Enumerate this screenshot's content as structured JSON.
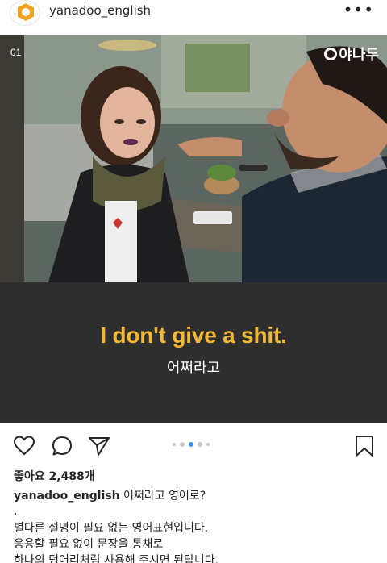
{
  "header": {
    "username": "yanadoo_english",
    "more_label": "•••"
  },
  "post": {
    "slide_number": "01",
    "brand_text": "야나두",
    "english_phrase": "I don't give a shit.",
    "korean_phrase": "어쩌라고"
  },
  "carousel": {
    "total": 5,
    "active_index": 2
  },
  "engagement": {
    "likes_label": "좋아요 2,488개"
  },
  "caption": {
    "username": "yanadoo_english",
    "title": "어쩌라고 영어로?",
    "dot": ".",
    "line1": "별다른 설명이 필요 없는 영어표현입니다.",
    "line2": "응용할 필요 없이 문장을 통채로",
    "line3": "하나의 덩어리처럼 사용해 주시면 된답니다."
  },
  "colors": {
    "accent_yellow": "#f2b735",
    "card_background": "#2e2e2e",
    "active_dot": "#3897f0"
  },
  "icons": [
    "profile-logo-icon",
    "more-options-icon",
    "heart-icon",
    "comment-icon",
    "share-icon",
    "bookmark-icon"
  ]
}
